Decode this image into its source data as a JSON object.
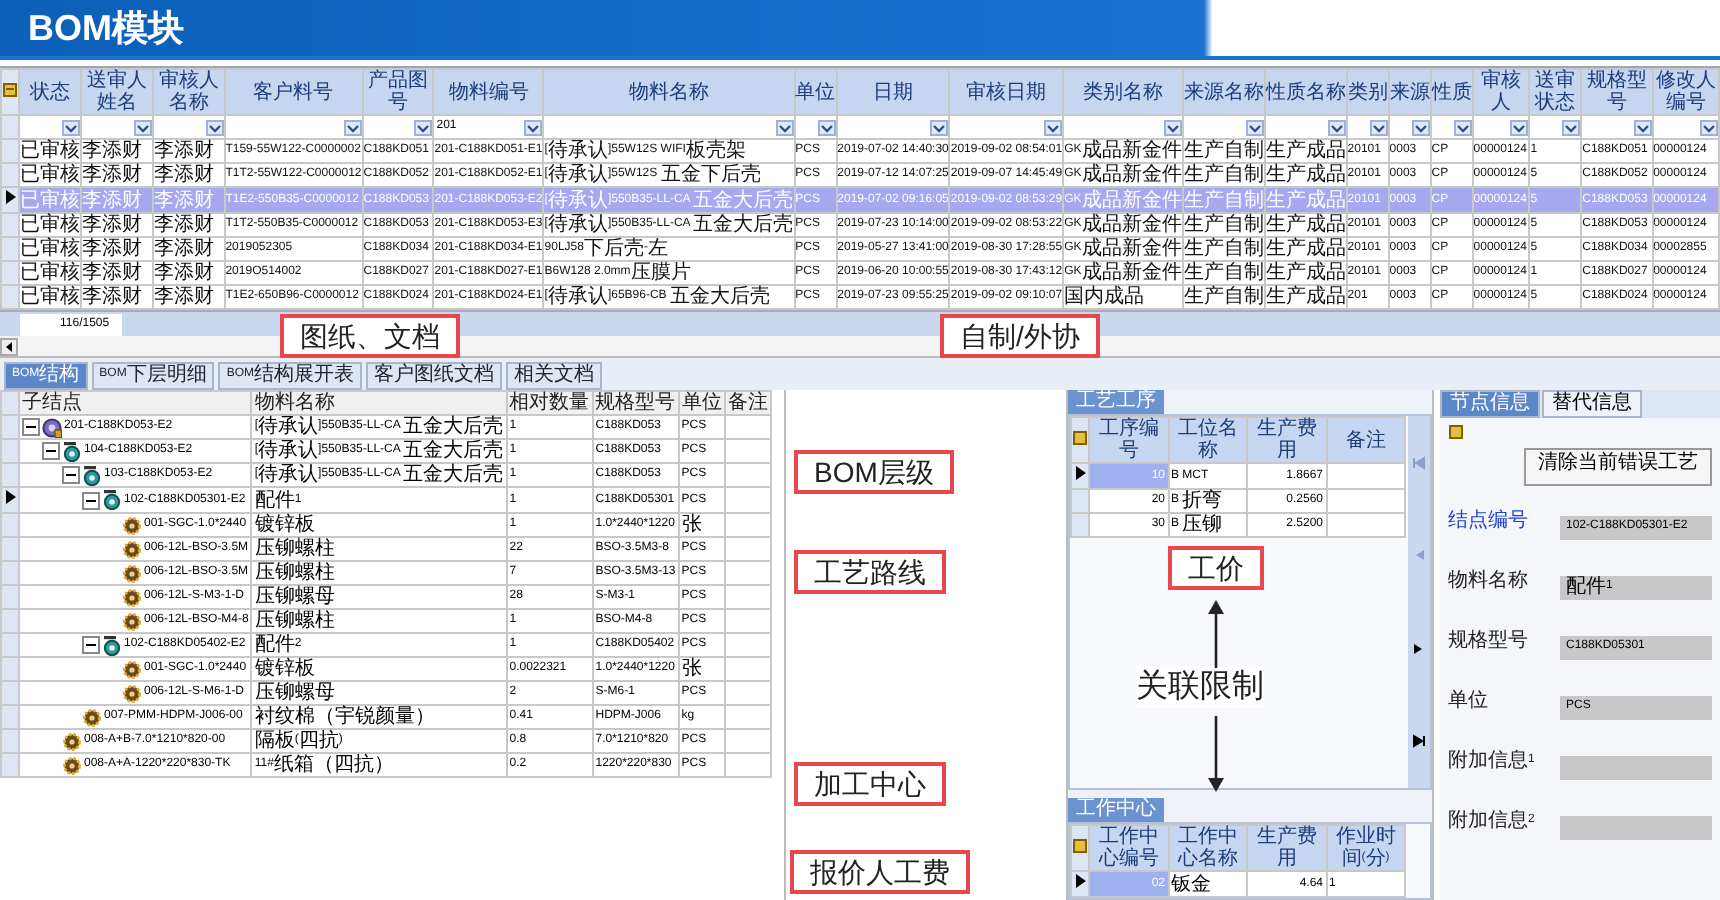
{
  "slide_title": "BOM模块",
  "grid": {
    "columns": [
      {
        "label": "状态"
      },
      {
        "label": "送审人姓名"
      },
      {
        "label": "审核人名称"
      },
      {
        "label": "客户料号"
      },
      {
        "label": "产品图号"
      },
      {
        "label": "物料编号",
        "filter": "201"
      },
      {
        "label": "物料名称"
      },
      {
        "label": "单位"
      },
      {
        "label": "日期"
      },
      {
        "label": "审核日期"
      },
      {
        "label": "类别名称"
      },
      {
        "label": "来源名称"
      },
      {
        "label": "性质名称"
      },
      {
        "label": "类别"
      },
      {
        "label": "来源"
      },
      {
        "label": "性质"
      },
      {
        "label": "审核人"
      },
      {
        "label": "送审状态"
      },
      {
        "label": "规格型号"
      },
      {
        "label": "修改人编号"
      }
    ],
    "rows": [
      {
        "selected": false,
        "cells": [
          "已审核",
          "李添财",
          "李添财",
          "T159-55W122-C0000002",
          "C188KD051",
          "201-C188KD051-E1",
          "[待承认]55W12S WIFI板壳架",
          "PCS",
          "2019-07-02 14:40:30",
          "2019-09-02 08:54:01",
          "GK成品新金件",
          "生产自制",
          "生产成品",
          "20101",
          "0003",
          "CP",
          "00000124",
          "1",
          "C188KD051",
          "00000124"
        ]
      },
      {
        "selected": false,
        "cells": [
          "已审核",
          "李添财",
          "李添财",
          "T1T2-55W122-C0000012",
          "C188KD052",
          "201-C188KD052-E1",
          "[待承认]55W12S 五金下后壳",
          "PCS",
          "2019-07-12 14:07:25",
          "2019-09-07 14:45:49",
          "GK成品新金件",
          "生产自制",
          "生产成品",
          "20101",
          "0003",
          "CP",
          "00000124",
          "5",
          "C188KD052",
          "00000124"
        ]
      },
      {
        "selected": true,
        "cells": [
          "已审核",
          "李添财",
          "李添财",
          "T1E2-550B35-C0000012",
          "C188KD053",
          "201-C188KD053-E2",
          "[待承认]550B35-LL-CA 五金大后壳",
          "PCS",
          "2019-07-02 09:16:05",
          "2019-09-02 08:53:29",
          "GK成品新金件",
          "生产自制",
          "生产成品",
          "20101",
          "0003",
          "CP",
          "00000124",
          "5",
          "C188KD053",
          "00000124"
        ]
      },
      {
        "selected": false,
        "cells": [
          "已审核",
          "李添财",
          "李添财",
          "T1T2-550B35-C0000012",
          "C188KD053",
          "201-C188KD053-E3",
          "[待承认]550B35-LL-CA 五金大后壳",
          "PCS",
          "2019-07-23 10:14:00",
          "2019-09-02 08:53:22",
          "GK成品新金件",
          "生产自制",
          "生产成品",
          "20101",
          "0003",
          "CP",
          "00000124",
          "5",
          "C188KD053",
          "00000124"
        ]
      },
      {
        "selected": false,
        "cells": [
          "已审核",
          "李添财",
          "李添财",
          "2019052305",
          "C188KD034",
          "201-C188KD034-E1",
          "90LJ58下后壳-左",
          "PCS",
          "2019-05-27 13:41:00",
          "2019-08-30 17:28:55",
          "GK成品新金件",
          "生产自制",
          "生产成品",
          "20101",
          "0003",
          "CP",
          "00000124",
          "5",
          "C188KD034",
          "00002855"
        ]
      },
      {
        "selected": false,
        "cells": [
          "已审核",
          "李添财",
          "李添财",
          "2019O514002",
          "C188KD027",
          "201-C188KD027-E1",
          "B6W128 2.0mm压膜片",
          "PCS",
          "2019-06-20 10:00:55",
          "2019-08-30 17:43:12",
          "GK成品新金件",
          "生产自制",
          "生产成品",
          "20101",
          "0003",
          "CP",
          "00000124",
          "1",
          "C188KD027",
          "00000124"
        ]
      },
      {
        "selected": false,
        "cells": [
          "已审核",
          "李添财",
          "李添财",
          "T1E2-650B96-C0000012",
          "C188KD024",
          "201-C188KD024-E1",
          "[待承认]65B96-CB 五金大后壳",
          "PCS",
          "2019-07-23 09:55:25",
          "2019-09-02 09:10:07",
          "国内成品",
          "生产自制",
          "生产成品",
          "201",
          "0003",
          "CP",
          "00000124",
          "5",
          "C188KD024",
          "00000124"
        ]
      }
    ],
    "record_count": "116/1505"
  },
  "tabs": [
    {
      "label": "BOM结构",
      "selected": true
    },
    {
      "label": "BOM下层明细",
      "selected": false
    },
    {
      "label": "BOM结构展开表",
      "selected": false
    },
    {
      "label": "客户图纸文档",
      "selected": false
    },
    {
      "label": "相关文档",
      "selected": false
    }
  ],
  "bom_tree": {
    "columns": [
      "子结点",
      "物料名称",
      "相对数量",
      "规格型号",
      "单位",
      "备注"
    ],
    "nodes": [
      {
        "node": "201-C188KD053-E2",
        "name": "[待承认]550B35-LL-CA 五金大后壳",
        "qty": "1",
        "spec": "C188KD053",
        "unit": "PCS",
        "kind": "product",
        "expanded": true,
        "selected": false,
        "children": [
          {
            "node": "104-C188KD053-E2",
            "name": "[待承认]550B35-LL-CA 五金大后壳",
            "qty": "1",
            "spec": "C188KD053",
            "unit": "PCS",
            "kind": "assembly",
            "expanded": true,
            "selected": false,
            "children": [
              {
                "node": "103-C188KD053-E2",
                "name": "[待承认]550B35-LL-CA 五金大后壳",
                "qty": "1",
                "spec": "C188KD053",
                "unit": "PCS",
                "kind": "assembly",
                "expanded": true,
                "selected": false,
                "children": [
                  {
                    "node": "102-C188KD05301-E2",
                    "name": "配件1",
                    "qty": "1",
                    "spec": "C188KD05301",
                    "unit": "PCS",
                    "kind": "assembly",
                    "expanded": true,
                    "selected": true,
                    "children": [
                      {
                        "node": "001-SGC-1.0*2440",
                        "name": "镀锌板",
                        "qty": "1",
                        "spec": "1.0*2440*1220",
                        "unit": "张",
                        "kind": "part",
                        "selected": false
                      },
                      {
                        "node": "006-12L-BSO-3.5M",
                        "name": "压铆螺柱",
                        "qty": "22",
                        "spec": "BSO-3.5M3-8",
                        "unit": "PCS",
                        "kind": "part",
                        "selected": false
                      },
                      {
                        "node": "006-12L-BSO-3.5M",
                        "name": "压铆螺柱",
                        "qty": "7",
                        "spec": "BSO-3.5M3-13",
                        "unit": "PCS",
                        "kind": "part",
                        "selected": false
                      },
                      {
                        "node": "006-12L-S-M3-1-D",
                        "name": "压铆螺母",
                        "qty": "28",
                        "spec": "S-M3-1",
                        "unit": "PCS",
                        "kind": "part",
                        "selected": false
                      },
                      {
                        "node": "006-12L-BSO-M4-8",
                        "name": "压铆螺柱",
                        "qty": "1",
                        "spec": "BSO-M4-8",
                        "unit": "PCS",
                        "kind": "part",
                        "selected": false
                      }
                    ]
                  },
                  {
                    "node": "102-C188KD05402-E2",
                    "name": "配件2",
                    "qty": "1",
                    "spec": "C188KD05402",
                    "unit": "PCS",
                    "kind": "assembly",
                    "expanded": true,
                    "selected": false,
                    "children": [
                      {
                        "node": "001-SGC-1.0*2440",
                        "name": "镀锌板",
                        "qty": "0.0022321",
                        "spec": "1.0*2440*1220",
                        "unit": "张",
                        "kind": "part",
                        "selected": false
                      },
                      {
                        "node": "006-12L-S-M6-1-D",
                        "name": "压铆螺母",
                        "qty": "2",
                        "spec": "S-M6-1",
                        "unit": "PCS",
                        "kind": "part",
                        "selected": false
                      }
                    ]
                  }
                ]
              },
              {
                "node": "007-PMM-HDPM-J006-00",
                "name": "衬纹棉（宇锐颜量）",
                "qty": "0.41",
                "spec": "HDPM-J006",
                "unit": "kg",
                "kind": "part",
                "selected": false
              }
            ]
          },
          {
            "node": "008-A+B-7.0*1210*820-00",
            "name": "隔板(四抗)",
            "qty": "0.8",
            "spec": "7.0*1210*820",
            "unit": "PCS",
            "kind": "part",
            "selected": false
          },
          {
            "node": "008-A+A-1220*220*830-TK",
            "name": "11#纸箱（四抗）",
            "qty": "0.2",
            "spec": "1220*220*830",
            "unit": "PCS",
            "kind": "part",
            "selected": false
          }
        ]
      }
    ]
  },
  "process": {
    "title": "工艺工序",
    "columns": [
      "工序编号",
      "工位名称",
      "生产费用",
      "备注"
    ],
    "rows": [
      {
        "selected": true,
        "cells": [
          "10",
          "B MCT",
          "1.8667"
        ]
      },
      {
        "selected": false,
        "cells": [
          "20",
          "B 折弯",
          "0.2560"
        ]
      },
      {
        "selected": false,
        "cells": [
          "30",
          "B 压铆",
          "2.5200"
        ]
      }
    ]
  },
  "work_center": {
    "title": "工作中心",
    "columns": [
      "工作中心编号",
      "工作中心名称",
      "生产费用",
      "作业时间(分)"
    ],
    "rows": [
      {
        "selected": true,
        "cells": [
          "02",
          "钣金",
          "4.64",
          "1"
        ]
      }
    ]
  },
  "node_info": {
    "tabs": [
      {
        "label": "节点信息",
        "selected": true
      },
      {
        "label": "替代信息",
        "selected": false
      }
    ],
    "button": "清除当前错误工艺",
    "fields": [
      {
        "label": "结点编号",
        "value": "102-C188KD05301-E2",
        "required": true
      },
      {
        "label": "物料名称",
        "value": "配件1",
        "required": false
      },
      {
        "label": "规格型号",
        "value": "C188KD05301",
        "required": false
      },
      {
        "label": "单位",
        "value": "PCS",
        "required": false
      },
      {
        "label": "附加信息1",
        "required": false
      },
      {
        "label": "附加信息2",
        "required": false
      }
    ]
  },
  "callouts": [
    {
      "text": "图纸、文档"
    },
    {
      "text": "自制/外协"
    },
    {
      "text": "BOM层级"
    },
    {
      "text": "工艺路线"
    },
    {
      "text": "工价"
    },
    {
      "text": "加工中心"
    },
    {
      "text": "报价人工费"
    }
  ],
  "relation_note": "关联限制"
}
